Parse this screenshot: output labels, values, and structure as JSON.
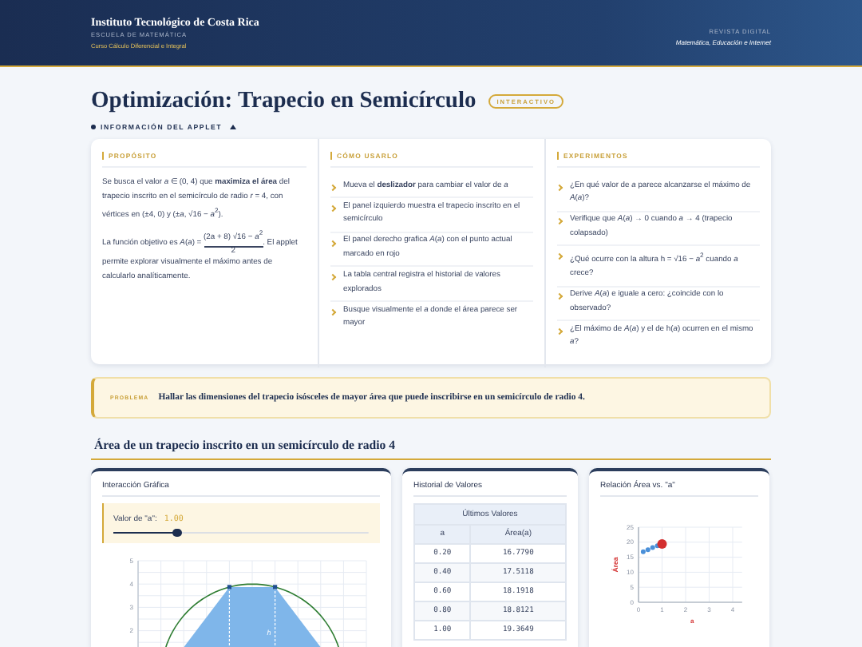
{
  "header": {
    "institution": "Instituto Tecnológico de Costa Rica",
    "school": "ESCUELA DE MATEMÁTICA",
    "course": "Curso Cálculo Diferencial e Integral",
    "journal": "REVISTA DIGITAL",
    "journal_subtitle": "Matemática, Educación e Internet"
  },
  "page": {
    "title": "Optimización: Trapecio en Semicírculo",
    "badge": "INTERACTIVO",
    "info_toggle": {
      "label": "INFORMACIÓN DEL APPLET",
      "expanded": true
    }
  },
  "info": {
    "purpose": {
      "heading": "PROPÓSITO",
      "paragraph": "Se busca el valor *a* ∈ (0, 4) que **maximiza el área** del trapecio inscrito en el semicírculo de radio *r* = 4, con vértices en (±4, 0) y (±*a*, √16 − *a*$^{2}$).",
      "objective": {
        "lead": "La función objetivo es *A*(*a*) =",
        "numerator": "(2a + 8) √16 − *a*$^{2}$",
        "denominator": "2",
        "tail": ". El applet permite explorar visualmente el máximo antes de calcularlo analíticamente."
      }
    },
    "how_to": {
      "heading": "CÓMO USARLO",
      "items": [
        "Mueva el **deslizador** para cambiar el valor de *a*",
        "El panel izquierdo muestra el trapecio inscrito en el semicírculo",
        "El panel derecho grafica *A*(*a*) con el punto actual marcado en rojo",
        "La tabla central registra el historial de valores explorados",
        "Busque visualmente el *a* donde el área parece ser mayor"
      ]
    },
    "experiments": {
      "heading": "EXPERIMENTOS",
      "items": [
        "¿En qué valor de *a* parece alcanzarse el máximo de *A*(*a*)?",
        "Verifique que *A*(*a*) → 0 cuando *a* → 4 (trapecio colapsado)",
        "¿Qué ocurre con la altura h = √16 − *a*$^{2}$ cuando *a* crece?",
        "Derive *A*(*a*) e iguale a cero: ¿coincide con lo observado?",
        "¿El máximo de *A*(*a*) y el de h(*a*) ocurren en el mismo *a*?"
      ]
    }
  },
  "problem": {
    "label": "PROBLEMA",
    "text": "Hallar las dimensiones del trapecio isósceles de mayor área que puede inscribirse en un semicírculo de radio 4."
  },
  "section_title": "Área de un trapecio inscrito en un semicírculo de radio 4",
  "interaction": {
    "title": "Interacción Gráfica",
    "slider": {
      "label": "Valor de \"a\":",
      "value": "1.00",
      "level": 0.25
    },
    "plot": {
      "y_tick_labels": [
        "5",
        "4",
        "3",
        "2"
      ],
      "height_label": "h"
    }
  },
  "history": {
    "title": "Historial de Valores",
    "caption": "Últimos Valores",
    "columns": [
      "a",
      "Área(a)"
    ],
    "rows": [
      [
        "0.20",
        "16.7790"
      ],
      [
        "0.40",
        "17.5118"
      ],
      [
        "0.60",
        "18.1918"
      ],
      [
        "0.80",
        "18.8121"
      ],
      [
        "1.00",
        "19.3649"
      ]
    ]
  },
  "relation": {
    "title": "Relación Área vs. \"a\"",
    "chart_data": {
      "type": "scatter",
      "grid": true,
      "xlabel": "a",
      "ylabel": "Área",
      "x": [
        0.2,
        0.4,
        0.6,
        0.8,
        1.0
      ],
      "xlim": [
        0,
        4.4
      ],
      "ylim": [
        0,
        25
      ],
      "xticks": [
        0,
        1,
        2,
        3,
        4
      ],
      "yticks": [
        0,
        5,
        10,
        15,
        20,
        25
      ],
      "series": [
        {
          "color": "#4a90d9",
          "values": [
            16.8,
            17.5,
            18.2,
            18.8,
            null
          ]
        },
        {
          "color": "#d32f2f",
          "values": [
            null,
            null,
            null,
            null,
            19.4
          ]
        }
      ]
    }
  }
}
